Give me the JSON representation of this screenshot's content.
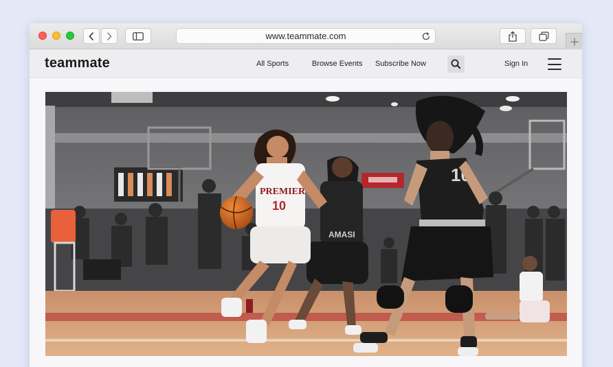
{
  "browser": {
    "url": "www.teammate.com",
    "icons": {
      "back": "chevron-left-icon",
      "forward": "chevron-right-icon",
      "sidebar": "sidebar-icon",
      "reload": "reload-icon",
      "share": "share-icon",
      "tabs": "tabs-icon",
      "new_tab": "plus-icon"
    }
  },
  "site": {
    "logo": "teammate",
    "nav": {
      "all_sports": "All Sports",
      "browse_events": "Browse Events",
      "subscribe": "Subscribe Now",
      "sign_in": "Sign In"
    },
    "icons": {
      "search": "search-icon",
      "menu": "hamburger-menu-icon"
    }
  },
  "hero": {
    "jersey_front": {
      "team": "PREMIER",
      "number": "10"
    },
    "jersey_back": {
      "number": "10"
    },
    "jersey_defender": "AMASI"
  },
  "colors": {
    "accent_red": "#b3272d",
    "page_bg": "#e3e9f7"
  }
}
